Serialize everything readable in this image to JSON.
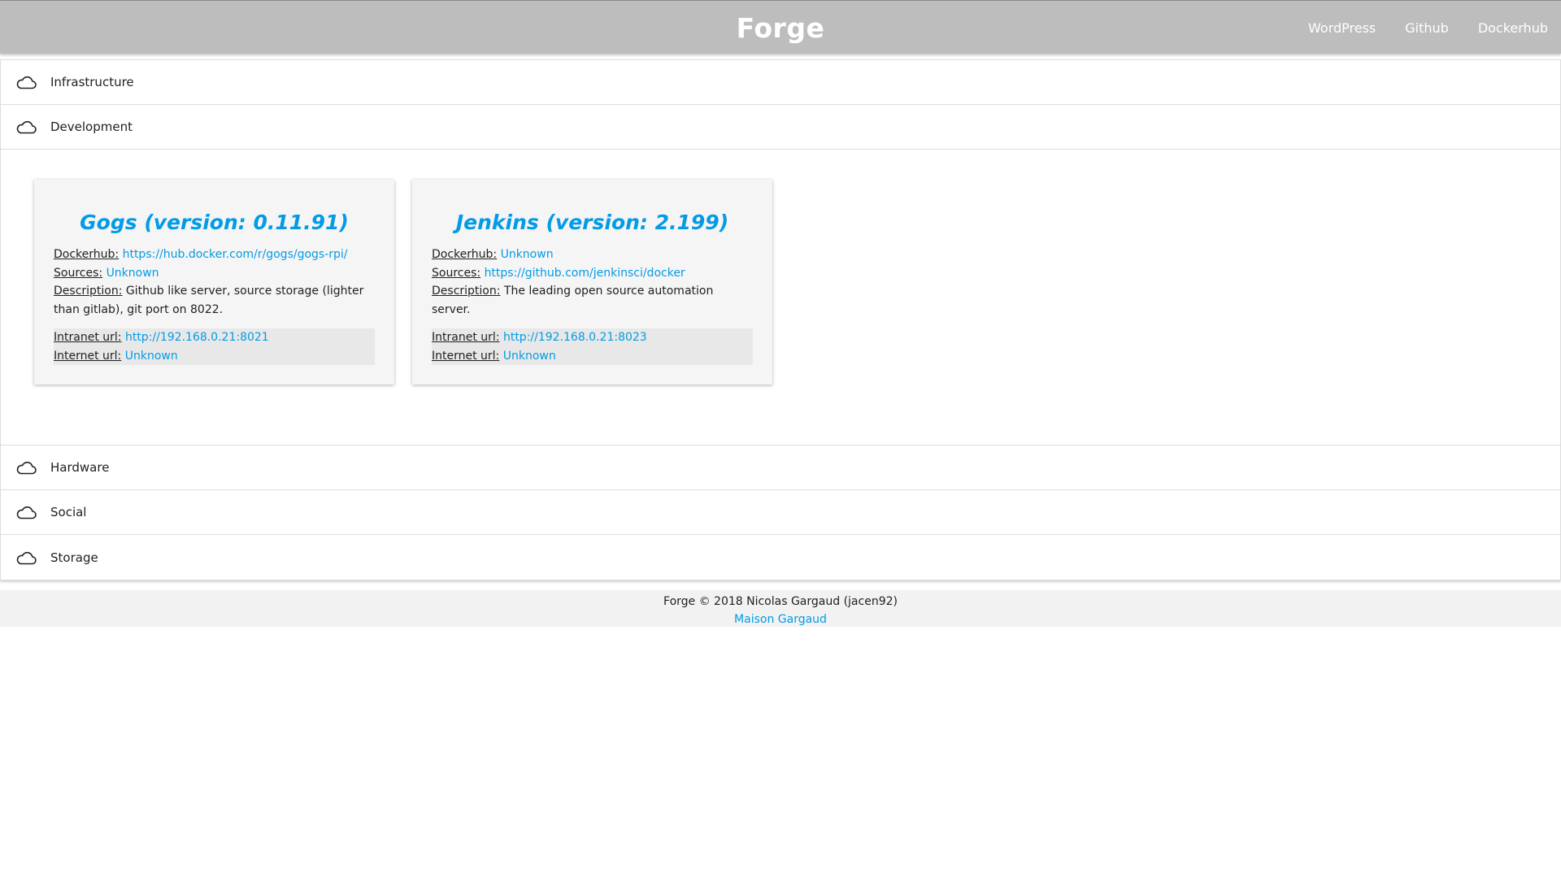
{
  "navbar": {
    "brand": "Forge",
    "links": [
      "WordPress",
      "Github",
      "Dockerhub"
    ]
  },
  "sections": [
    {
      "label": "Infrastructure",
      "icon": "cloud-icon",
      "expanded": false
    },
    {
      "label": "Development",
      "icon": "cloud-icon",
      "expanded": true
    },
    {
      "label": "Hardware",
      "icon": "cloud-icon",
      "expanded": false
    },
    {
      "label": "Social",
      "icon": "cloud-icon",
      "expanded": false
    },
    {
      "label": "Storage",
      "icon": "cloud-icon",
      "expanded": false
    }
  ],
  "cards": [
    {
      "title": "Gogs (version: 0.11.91)",
      "dockerhub_label": "Dockerhub:",
      "dockerhub": "https://hub.docker.com/r/gogs/gogs-rpi/",
      "sources_label": "Sources:",
      "sources": "Unknown",
      "description_label": "Description:",
      "description": "Github like server, source storage (lighter than gitlab), git port on 8022.",
      "intranet_label": "Intranet url:",
      "intranet": "http://192.168.0.21:8021",
      "internet_label": "Internet url:",
      "internet": "Unknown"
    },
    {
      "title": "Jenkins (version: 2.199)",
      "dockerhub_label": "Dockerhub:",
      "dockerhub": "Unknown",
      "sources_label": "Sources:",
      "sources": "https://github.com/jenkinsci/docker",
      "description_label": "Description:",
      "description": "The leading open source automation server.",
      "intranet_label": "Intranet url:",
      "intranet": "http://192.168.0.21:8023",
      "internet_label": "Internet url:",
      "internet": "Unknown"
    }
  ],
  "footer": {
    "copyright": "Forge © 2018 Nicolas Gargaud (jacen92)",
    "link": "Maison Gargaud"
  },
  "colors": {
    "navbar": "#bdbdbd",
    "link": "#039be5",
    "card_bg": "#f5f5f5",
    "footer_bg": "#f2f2f2"
  }
}
